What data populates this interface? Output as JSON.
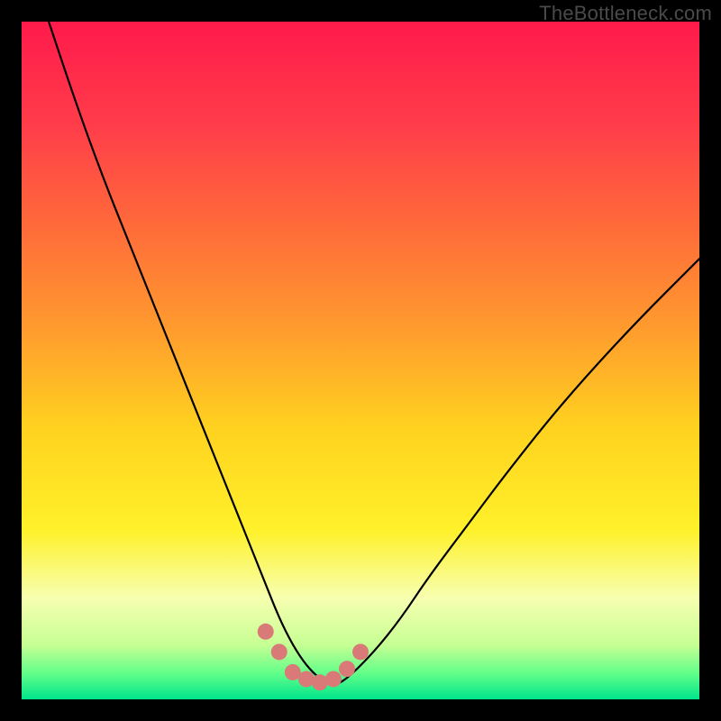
{
  "watermark": "TheBottleneck.com",
  "chart_data": {
    "type": "line",
    "title": "",
    "xlabel": "",
    "ylabel": "",
    "xlim": [
      0,
      100
    ],
    "ylim": [
      0,
      100
    ],
    "background_gradient": {
      "direction": "vertical",
      "stops": [
        {
          "pos": 0.0,
          "color": "#ff1a4b"
        },
        {
          "pos": 0.15,
          "color": "#ff3c4a"
        },
        {
          "pos": 0.3,
          "color": "#ff6a3a"
        },
        {
          "pos": 0.45,
          "color": "#ff9a2e"
        },
        {
          "pos": 0.6,
          "color": "#ffd21f"
        },
        {
          "pos": 0.75,
          "color": "#fff12a"
        },
        {
          "pos": 0.85,
          "color": "#f7ffb0"
        },
        {
          "pos": 0.92,
          "color": "#c6ff94"
        },
        {
          "pos": 0.96,
          "color": "#66ff8a"
        },
        {
          "pos": 1.0,
          "color": "#00e58b"
        }
      ]
    },
    "series": [
      {
        "name": "bottleneck-curve",
        "stroke": "#000000",
        "stroke_width": 2.2,
        "x": [
          4,
          8,
          12,
          16,
          20,
          24,
          28,
          32,
          34,
          36,
          38,
          40,
          42,
          44,
          46,
          48,
          52,
          56,
          60,
          66,
          72,
          80,
          90,
          100
        ],
        "y": [
          100,
          88,
          77,
          67,
          57,
          47,
          37,
          27,
          22,
          17,
          12,
          8,
          5,
          3,
          2,
          3,
          7,
          12,
          18,
          26,
          34,
          44,
          55,
          65
        ]
      }
    ],
    "markers": {
      "name": "highlight-points",
      "fill": "#d97a79",
      "radius": 9,
      "points": [
        {
          "x": 36,
          "y": 10
        },
        {
          "x": 38,
          "y": 7
        },
        {
          "x": 40,
          "y": 4
        },
        {
          "x": 42,
          "y": 3
        },
        {
          "x": 44,
          "y": 2.5
        },
        {
          "x": 46,
          "y": 3
        },
        {
          "x": 48,
          "y": 4.5
        },
        {
          "x": 50,
          "y": 7
        }
      ]
    }
  }
}
